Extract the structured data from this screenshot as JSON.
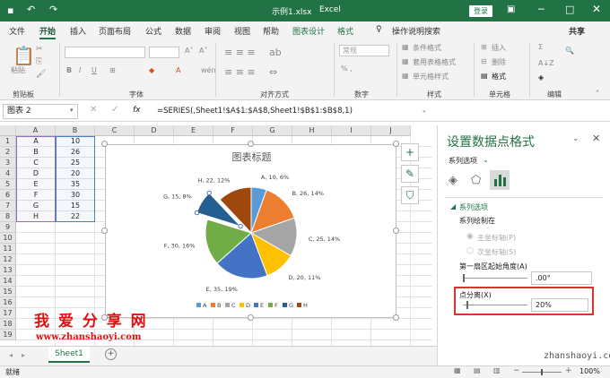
{
  "titlebar": {
    "filename": "示例1.xlsx",
    "app": "Excel",
    "login_label": "登录"
  },
  "menu": {
    "tabs": [
      "文件",
      "开始",
      "插入",
      "页面布局",
      "公式",
      "数据",
      "审阅",
      "视图",
      "帮助",
      "图表设计",
      "格式"
    ],
    "help_label": "操作说明搜索",
    "share_label": "共享"
  },
  "ribbon": {
    "groups": [
      "剪贴板",
      "字体",
      "对齐方式",
      "数字",
      "样式",
      "单元格",
      "编辑"
    ],
    "paste_label": "粘贴",
    "number_format": "常规",
    "style_items": [
      "条件格式",
      "套用表格格式",
      "单元格样式"
    ],
    "cell_items": [
      "插入",
      "删除",
      "格式"
    ]
  },
  "formula_bar": {
    "name_box": "图表 2",
    "fx": "fx",
    "formula": "=SERIES(,Sheet1!$A$1:$A$8,Sheet1!$B$1:$B$8,1)"
  },
  "sheet": {
    "columns": [
      "A",
      "B",
      "C",
      "D",
      "E",
      "F",
      "G",
      "H",
      "I",
      "J"
    ],
    "rows": [
      "1",
      "2",
      "3",
      "4",
      "5",
      "6",
      "7",
      "8",
      "9",
      "10",
      "11",
      "12",
      "13",
      "14",
      "15",
      "16",
      "17",
      "18",
      "19"
    ],
    "data": [
      [
        "A",
        "10"
      ],
      [
        "B",
        "26"
      ],
      [
        "C",
        "25"
      ],
      [
        "D",
        "20"
      ],
      [
        "E",
        "35"
      ],
      [
        "F",
        "30"
      ],
      [
        "G",
        "15"
      ],
      [
        "H",
        "22"
      ]
    ]
  },
  "chart_data": {
    "type": "pie",
    "title": "图表标题",
    "categories": [
      "A",
      "B",
      "C",
      "D",
      "E",
      "F",
      "G",
      "H"
    ],
    "values": [
      10,
      26,
      25,
      20,
      35,
      30,
      15,
      22
    ],
    "percent_labels": [
      "A, 10, 6%",
      "B, 26, 14%",
      "C, 25, 14%",
      "D, 20, 11%",
      "E, 35, 19%",
      "F, 30, 16%",
      "G, 15, 8%",
      "H, 22, 12%"
    ],
    "colors": [
      "#5B9BD5",
      "#ED7D31",
      "#A5A5A5",
      "#FFC000",
      "#4472C4",
      "#70AD47",
      "#255E91",
      "#9E480E"
    ],
    "exploded_point": "G",
    "legend_position": "bottom"
  },
  "pane": {
    "title": "设置数据点格式",
    "dropdown": "系列选项",
    "section": "系列选项",
    "plot_on": "系列绘制在",
    "primary_axis": "主坐标轴(P)",
    "secondary_axis": "次坐标轴(S)",
    "angle_label": "第一扇区起始角度(A)",
    "angle_value": ".00°",
    "explosion_label": "点分离(X)",
    "explosion_value": "20%"
  },
  "sheet_tabs": {
    "active": "Sheet1",
    "add_label": "+"
  },
  "status": {
    "ready": "就绪",
    "zoom": "100%"
  },
  "watermark": {
    "brand": "我 爱 分 享 网",
    "url": "www.zhanshaoyi.com",
    "url2": "zhanshaoyi.com"
  }
}
